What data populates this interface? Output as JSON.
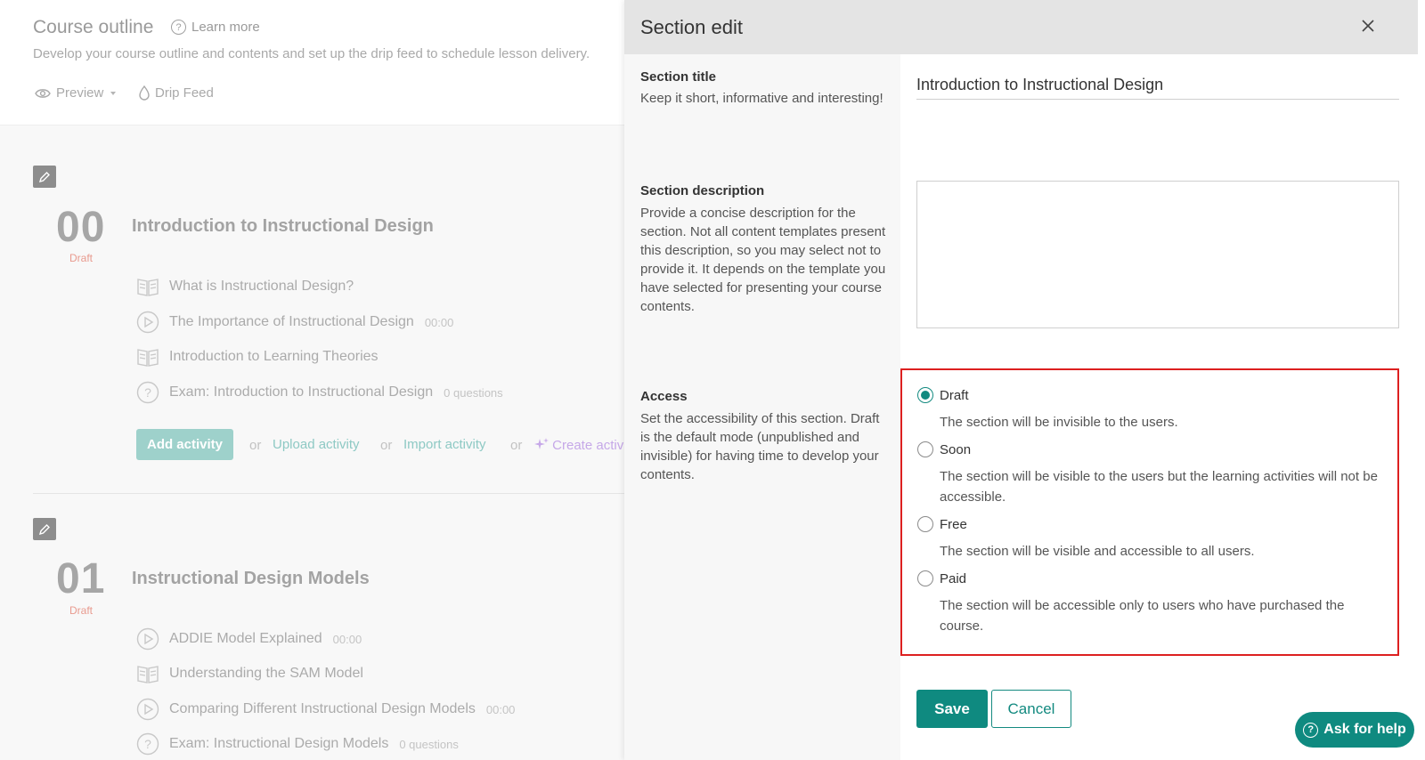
{
  "outline": {
    "title": "Course outline",
    "learn_more": "Learn more",
    "subtitle": "Develop your course outline and contents and set up the drip feed to schedule lesson delivery.",
    "preview": "Preview",
    "drip_feed": "Drip Feed",
    "sections": [
      {
        "number": "00",
        "status": "Draft",
        "title": "Introduction to Instructional Design",
        "activities": [
          {
            "icon": "book-icon",
            "title": "What is Instructional Design?",
            "meta": ""
          },
          {
            "icon": "play-icon",
            "title": "The Importance of Instructional Design",
            "meta": "00:00"
          },
          {
            "icon": "book-icon",
            "title": "Introduction to Learning Theories",
            "meta": ""
          },
          {
            "icon": "question-icon",
            "title": "Exam: Introduction to Instructional Design",
            "meta": "0 questions"
          }
        ]
      },
      {
        "number": "01",
        "status": "Draft",
        "title": "Instructional Design Models",
        "activities": [
          {
            "icon": "play-icon",
            "title": "ADDIE Model Explained",
            "meta": "00:00"
          },
          {
            "icon": "book-icon",
            "title": "Understanding the SAM Model",
            "meta": ""
          },
          {
            "icon": "play-icon",
            "title": "Comparing Different Instructional Design Models",
            "meta": "00:00"
          },
          {
            "icon": "question-icon",
            "title": "Exam: Instructional Design Models",
            "meta": "0 questions"
          }
        ]
      }
    ],
    "actions": {
      "add_activity": "Add activity",
      "or": "or",
      "upload_activity": "Upload activity",
      "import_activity": "Import activity",
      "create_activity": "Create activi"
    }
  },
  "panel": {
    "title": "Section edit",
    "section_title": {
      "label": "Section title",
      "help": "Keep it short, informative and interesting!",
      "value": "Introduction to Instructional Design"
    },
    "section_description": {
      "label": "Section description",
      "help": "Provide a concise description for the section. Not all content templates present this description, so you may select not to provide it. It depends on the template you have selected for presenting your course contents.",
      "value": ""
    },
    "access": {
      "label": "Access",
      "help": "Set the accessibility of this section. Draft is the default mode (unpublished and invisible) for having time to develop your contents.",
      "selected": "Draft",
      "options": [
        {
          "label": "Draft",
          "desc": "The section will be invisible to the users."
        },
        {
          "label": "Soon",
          "desc": "The section will be visible to the users but the learning activities will not be accessible."
        },
        {
          "label": "Free",
          "desc": "The section will be visible and accessible to all users."
        },
        {
          "label": "Paid",
          "desc": "The section will be accessible only to users who have purchased the course."
        }
      ]
    },
    "save": "Save",
    "cancel": "Cancel",
    "ask_for_help": "Ask for help"
  },
  "colors": {
    "accent": "#0f8a80",
    "highlight_border": "#dd2020",
    "draft_status": "#e89a8e"
  }
}
